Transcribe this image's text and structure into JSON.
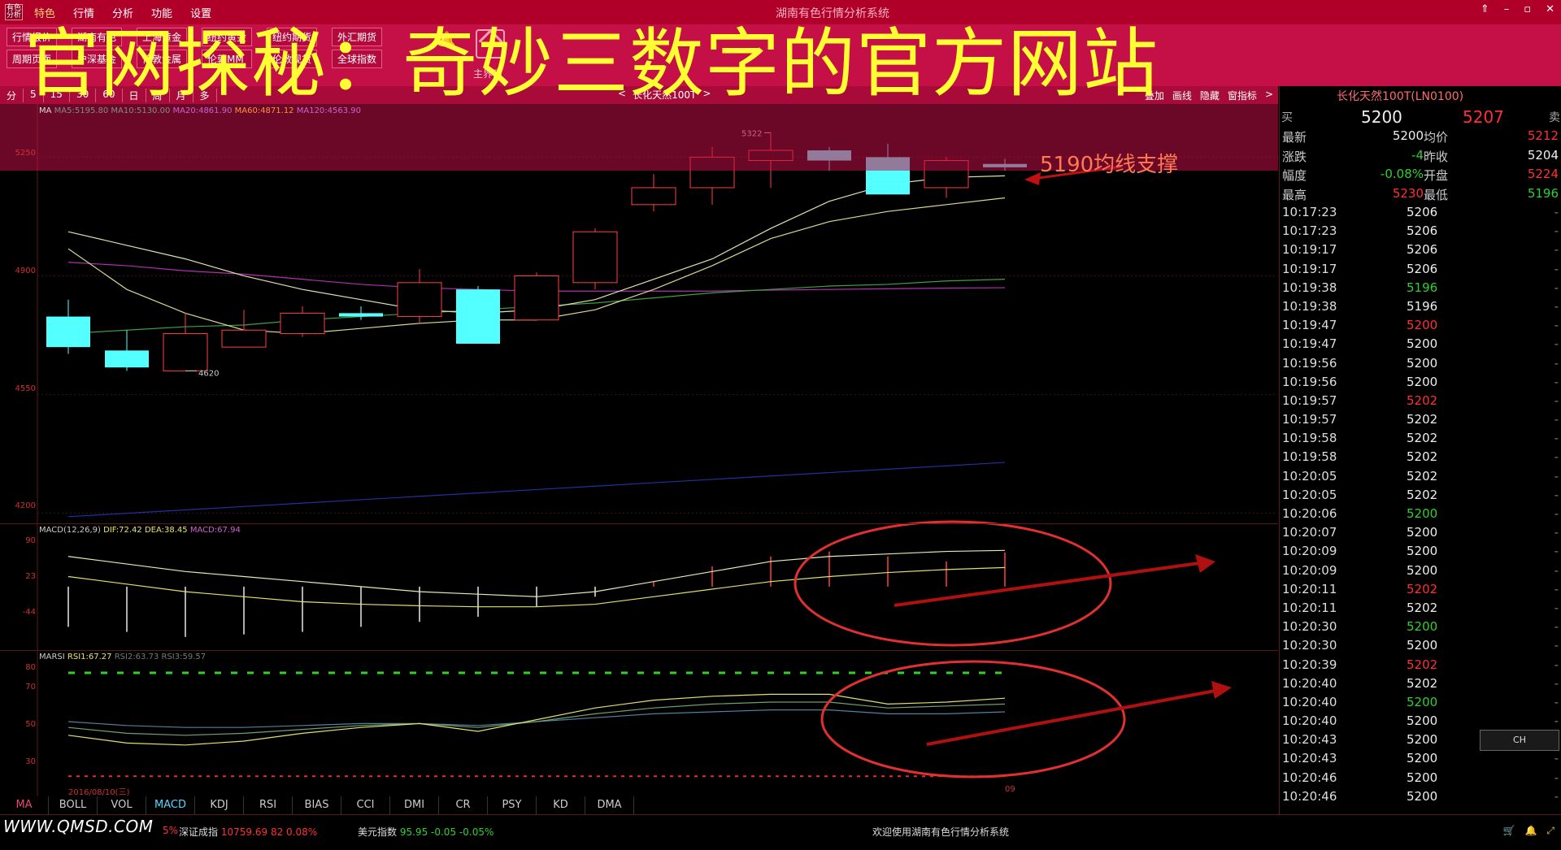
{
  "window": {
    "app_title": "湖南有色行情分析系统",
    "menu": [
      "特色",
      "行情",
      "分析",
      "功能",
      "设置"
    ],
    "controls": [
      "⇑",
      "–",
      "▫",
      "✕"
    ]
  },
  "overlay_title": "官网探秘：奇妙三数字的官方网站",
  "toolbar": {
    "groups": [
      {
        "items": [
          "行情报价",
          "周期页面"
        ]
      },
      {
        "items": [
          "湖南有色",
          "沪深基金"
        ]
      },
      {
        "items": [
          "上海黄金",
          "伦敦金属"
        ]
      },
      {
        "items": [
          "纽约黄金",
          "伦敦MM"
        ]
      },
      {
        "items": [
          "纽约期货",
          "伦敦现货"
        ]
      },
      {
        "items": [
          "外汇期货",
          "全球指数"
        ]
      }
    ],
    "bell_label": "预警",
    "home_label": "主界面",
    "extra_label": "首页"
  },
  "periodbar": {
    "items": [
      "分",
      "5",
      "15",
      "30",
      "60",
      "日",
      "周",
      "月",
      "多"
    ],
    "stock_prev": "<",
    "stock_name": "长化天然100T",
    "stock_next": ">",
    "extras": [
      "叠加",
      "画线",
      "隐藏",
      "窗指标",
      ">"
    ]
  },
  "main_info": {
    "label": "MA",
    "ma5": "MA5:5195.80",
    "ma10": "MA10:5130.00",
    "ma20": "MA20:4861.90",
    "ma60": "MA60:4871.12",
    "extra": "MA120:4563.90"
  },
  "price_axis": [
    "5250",
    "4900",
    "4550",
    "4200"
  ],
  "annotations": {
    "high_label": "5322",
    "low_label": "4620",
    "support": "5190均线支撑"
  },
  "macd": {
    "title": "MACD(12,26,9)",
    "dif": "DIF:72.42",
    "dea": "DEA:38.45",
    "macd": "MACD:67.94",
    "axis": [
      "90",
      "23",
      "-44"
    ]
  },
  "rsi": {
    "title": "MARSI",
    "rsi1": "RSI1:67.27",
    "rsi2": "RSI2:63.73",
    "rsi3": "RSI3:59.57",
    "axis": [
      "80",
      "70",
      "50",
      "30"
    ],
    "date_label": "2016/08/10(三)",
    "end_label": "09"
  },
  "indicator_tabs": [
    "MA",
    "BOLL",
    "VOL",
    "MACD",
    "KDJ",
    "RSI",
    "BIAS",
    "CCI",
    "DMI",
    "CR",
    "PSY",
    "KD",
    "DMA"
  ],
  "statusbar": {
    "url": "WWW.QMSD.COM",
    "sh_pct": "5%",
    "sz_label": "深证成指",
    "sz_value": "10759.69",
    "sz_change": "82",
    "sz_pct": "0.08%",
    "usd_label": "美元指数",
    "usd_value": "95.95",
    "usd_change": "-0.05",
    "usd_pct": "-0.05%",
    "welcome": "欢迎使用湖南有色行情分析系统"
  },
  "quote": {
    "name": "长化天然100T(LN0100)",
    "buy_label": "买",
    "sell_label": "卖",
    "buy_value": "5200",
    "sell_value": "5207",
    "rows": [
      {
        "l1": "最新",
        "v1": "5200",
        "l2": "均价",
        "v2": "5212",
        "c1": "w",
        "c2": "r"
      },
      {
        "l1": "涨跌",
        "v1": "-4",
        "l2": "昨收",
        "v2": "5204",
        "c1": "gg",
        "c2": "w"
      },
      {
        "l1": "幅度",
        "v1": "-0.08%",
        "l2": "开盘",
        "v2": "5224",
        "c1": "gg",
        "c2": "r"
      },
      {
        "l1": "最高",
        "v1": "5230",
        "l2": "最低",
        "v2": "5196",
        "c1": "r",
        "c2": "gg"
      }
    ],
    "ticks": [
      {
        "t": "10:17:23",
        "p": "5206",
        "c": "w"
      },
      {
        "t": "10:17:23",
        "p": "5206",
        "c": "w"
      },
      {
        "t": "10:19:17",
        "p": "5206",
        "c": "w"
      },
      {
        "t": "10:19:17",
        "p": "5206",
        "c": "w"
      },
      {
        "t": "10:19:38",
        "p": "5196",
        "c": "gg"
      },
      {
        "t": "10:19:38",
        "p": "5196",
        "c": "w"
      },
      {
        "t": "10:19:47",
        "p": "5200",
        "c": "r"
      },
      {
        "t": "10:19:47",
        "p": "5200",
        "c": "w"
      },
      {
        "t": "10:19:56",
        "p": "5200",
        "c": "w"
      },
      {
        "t": "10:19:56",
        "p": "5200",
        "c": "w"
      },
      {
        "t": "10:19:57",
        "p": "5202",
        "c": "r"
      },
      {
        "t": "10:19:57",
        "p": "5202",
        "c": "w"
      },
      {
        "t": "10:19:58",
        "p": "5202",
        "c": "w"
      },
      {
        "t": "10:19:58",
        "p": "5202",
        "c": "w"
      },
      {
        "t": "10:20:05",
        "p": "5202",
        "c": "w"
      },
      {
        "t": "10:20:05",
        "p": "5202",
        "c": "w"
      },
      {
        "t": "10:20:06",
        "p": "5200",
        "c": "gg"
      },
      {
        "t": "10:20:07",
        "p": "5200",
        "c": "w"
      },
      {
        "t": "10:20:09",
        "p": "5200",
        "c": "w"
      },
      {
        "t": "10:20:09",
        "p": "5200",
        "c": "w"
      },
      {
        "t": "10:20:11",
        "p": "5202",
        "c": "r"
      },
      {
        "t": "10:20:11",
        "p": "5202",
        "c": "w"
      },
      {
        "t": "10:20:30",
        "p": "5200",
        "c": "gg"
      },
      {
        "t": "10:20:30",
        "p": "5200",
        "c": "w"
      },
      {
        "t": "10:20:39",
        "p": "5202",
        "c": "r"
      },
      {
        "t": "10:20:40",
        "p": "5202",
        "c": "w"
      },
      {
        "t": "10:20:40",
        "p": "5200",
        "c": "gg"
      },
      {
        "t": "10:20:40",
        "p": "5200",
        "c": "w"
      },
      {
        "t": "10:20:43",
        "p": "5200",
        "c": "w"
      },
      {
        "t": "10:20:43",
        "p": "5200",
        "c": "w"
      },
      {
        "t": "10:20:46",
        "p": "5200",
        "c": "w"
      },
      {
        "t": "10:20:46",
        "p": "5200",
        "c": "w"
      }
    ]
  },
  "ime": "CH",
  "chart_data": {
    "type": "candlestick",
    "candles": [
      {
        "o": 4780,
        "c": 4690,
        "h": 4830,
        "l": 4670
      },
      {
        "o": 4680,
        "c": 4630,
        "h": 4740,
        "l": 4620
      },
      {
        "o": 4620,
        "c": 4730,
        "h": 4790,
        "l": 4620
      },
      {
        "o": 4690,
        "c": 4740,
        "h": 4800,
        "l": 4690
      },
      {
        "o": 4730,
        "c": 4790,
        "h": 4810,
        "l": 4720
      },
      {
        "o": 4790,
        "c": 4780,
        "h": 4810,
        "l": 4770
      },
      {
        "o": 4780,
        "c": 4880,
        "h": 4920,
        "l": 4760
      },
      {
        "o": 4860,
        "c": 4700,
        "h": 4870,
        "l": 4700
      },
      {
        "o": 4770,
        "c": 4900,
        "h": 4910,
        "l": 4770
      },
      {
        "o": 4880,
        "c": 5030,
        "h": 5040,
        "l": 4860
      },
      {
        "o": 5110,
        "c": 5160,
        "h": 5200,
        "l": 5090
      },
      {
        "o": 5160,
        "c": 5250,
        "h": 5280,
        "l": 5110
      },
      {
        "o": 5240,
        "c": 5270,
        "h": 5322,
        "l": 5160
      },
      {
        "o": 5270,
        "c": 5240,
        "h": 5280,
        "l": 5210
      },
      {
        "o": 5250,
        "c": 5140,
        "h": 5290,
        "l": 5140
      },
      {
        "o": 5160,
        "c": 5240,
        "h": 5250,
        "l": 5130
      },
      {
        "o": 5230,
        "c": 5220,
        "h": 5245,
        "l": 5210
      }
    ],
    "ylim": [
      4180,
      5330
    ],
    "ma_short": [
      5030,
      4990,
      4950,
      4900,
      4860,
      4830,
      4800,
      4790,
      4800,
      4830,
      4890,
      4950,
      5040,
      5120,
      5170,
      5190,
      5195
    ],
    "ma_mid": [
      4980,
      4860,
      4790,
      4740,
      4730,
      4745,
      4760,
      4770,
      4770,
      4800,
      4860,
      4930,
      5010,
      5060,
      5090,
      5110,
      5130
    ],
    "ma_long": [
      4730,
      4740,
      4750,
      4755,
      4770,
      4780,
      4790,
      4800,
      4810,
      4820,
      4835,
      4850,
      4860,
      4870,
      4875,
      4885,
      4890
    ],
    "ma_purple": [
      4940,
      4930,
      4915,
      4905,
      4890,
      4875,
      4865,
      4860,
      4855,
      4855,
      4855,
      4855,
      4858,
      4860,
      4862,
      4864,
      4865
    ],
    "ma_blue": [
      4190,
      4200,
      4210,
      4220,
      4230,
      4240,
      4250,
      4260,
      4270,
      4280,
      4290,
      4300,
      4310,
      4320,
      4330,
      4340,
      4350
    ],
    "macd_dif": [
      60,
      45,
      30,
      20,
      10,
      0,
      -10,
      -15,
      -20,
      -10,
      10,
      30,
      50,
      60,
      65,
      70,
      72
    ],
    "macd_dea": [
      20,
      5,
      -10,
      -20,
      -30,
      -35,
      -38,
      -40,
      -40,
      -35,
      -20,
      -5,
      10,
      20,
      28,
      34,
      38
    ],
    "macd_hist": [
      -80,
      -90,
      -100,
      -95,
      -90,
      -80,
      -70,
      -60,
      -40,
      -20,
      10,
      40,
      60,
      70,
      60,
      50,
      68
    ],
    "rsi1": [
      48,
      44,
      43,
      45,
      49,
      52,
      54,
      50,
      56,
      62,
      66,
      68,
      69,
      69,
      64,
      65,
      67
    ],
    "rsi2": [
      52,
      49,
      48,
      49,
      51,
      53,
      54,
      52,
      55,
      59,
      62,
      64,
      65,
      65,
      62,
      63,
      64
    ],
    "rsi3": [
      55,
      53,
      52,
      52,
      53,
      54,
      54,
      53,
      55,
      57,
      59,
      60,
      61,
      61,
      59,
      59,
      60
    ]
  }
}
